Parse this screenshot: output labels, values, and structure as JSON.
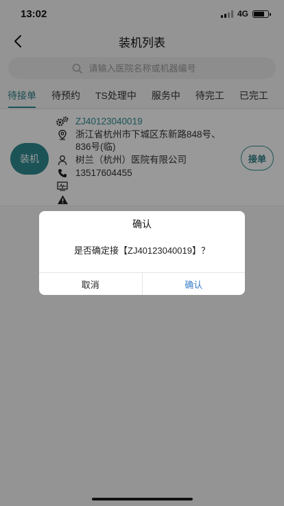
{
  "status_bar": {
    "time": "13:02",
    "network": "4G"
  },
  "nav": {
    "title": "装机列表",
    "back_icon": "chevron-left-icon"
  },
  "search": {
    "placeholder": "请输入医院名称或机器编号",
    "icon": "search-icon"
  },
  "tabs": [
    {
      "label": "待接单",
      "active": true
    },
    {
      "label": "待预约",
      "active": false
    },
    {
      "label": "TS处理中",
      "active": false
    },
    {
      "label": "服务中",
      "active": false
    },
    {
      "label": "待完工",
      "active": false
    },
    {
      "label": "已完工",
      "active": false
    }
  ],
  "order": {
    "type_label": "装机",
    "order_no": "ZJ40123040019",
    "address": "浙江省杭州市下城区东新路848号、836号(临)",
    "customer": "树兰（杭州）医院有限公司",
    "phone": "13517604455",
    "device": "",
    "alert": "",
    "accept_label": "接单"
  },
  "dialog": {
    "title": "确认",
    "message": "是否确定接【ZJ40123040019】？",
    "cancel_label": "取消",
    "confirm_label": "确认"
  },
  "colors": {
    "accent": "#2e8a91",
    "confirm_text": "#3a7ec9",
    "overlay": "rgba(0,0,0,0.4)"
  }
}
